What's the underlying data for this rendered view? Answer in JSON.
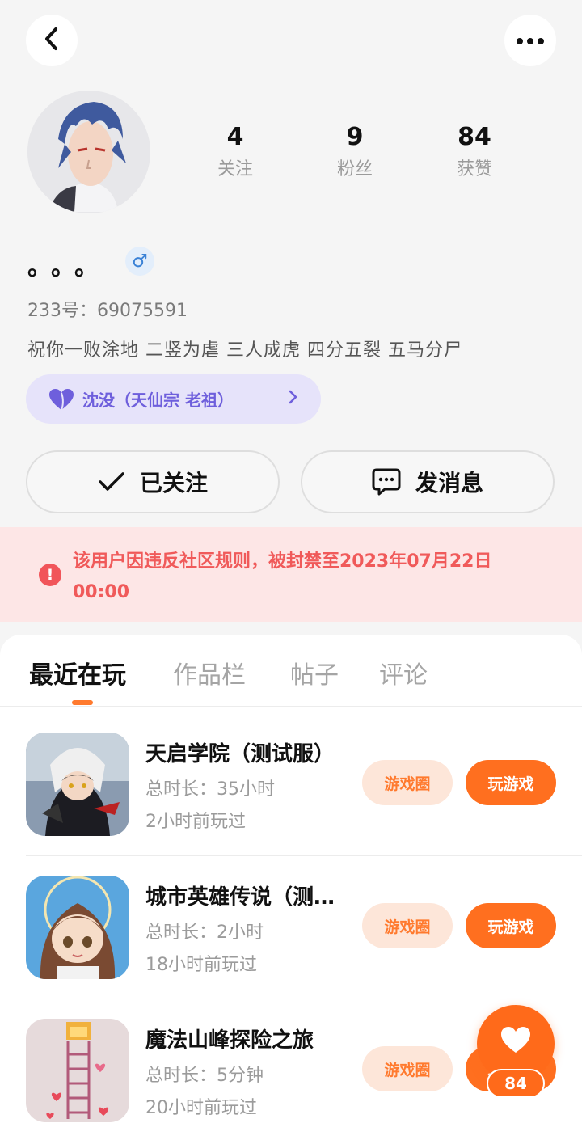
{
  "profile": {
    "name": "。。。",
    "gender_symbol": "♂",
    "uid_label": "233号：",
    "uid_value": "69075591",
    "bio": "祝你一败涂地 二竖为虐 三人成虎 四分五裂 五马分尸",
    "sect_label": "沈没（天仙宗 老祖）",
    "stats": [
      {
        "value": "4",
        "label": "关注"
      },
      {
        "value": "9",
        "label": "粉丝"
      },
      {
        "value": "84",
        "label": "获赞"
      }
    ]
  },
  "actions": {
    "follow_label": "已关注",
    "message_label": "发消息"
  },
  "ban_notice": "该用户因违反社区规则，被封禁至2023年07月22日 00:00",
  "tabs": [
    "最近在玩",
    "作品栏",
    "帖子",
    "评论"
  ],
  "active_tab": "最近在玩",
  "games": [
    {
      "title": "天启学院（测试服）",
      "duration": "总时长：35小时",
      "last_played": "2小时前玩过",
      "circle_label": "游戏圈",
      "play_label": "玩游戏"
    },
    {
      "title": "城市英雄传说（测试服）",
      "duration": "总时长：2小时",
      "last_played": "18小时前玩过",
      "circle_label": "游戏圈",
      "play_label": "玩游戏"
    },
    {
      "title": "魔法山峰探险之旅",
      "duration": "总时长：5分钟",
      "last_played": "20小时前玩过",
      "circle_label": "游戏圈",
      "play_label": "玩游戏"
    }
  ],
  "like_fab": {
    "count": "84"
  },
  "icons": {
    "back": "back-arrow-icon",
    "more": "more-dots-icon",
    "check": "check-icon",
    "message": "chat-bubble-icon",
    "sect": "heart-icon",
    "alert": "alert-icon",
    "like": "heart-icon"
  },
  "colors": {
    "accent": "#ff6f1f",
    "ban_bg": "#fde6e6",
    "ban_text": "#f05a5a",
    "sect_bg": "#e6e3fa",
    "sect_text": "#6e5fdc"
  }
}
